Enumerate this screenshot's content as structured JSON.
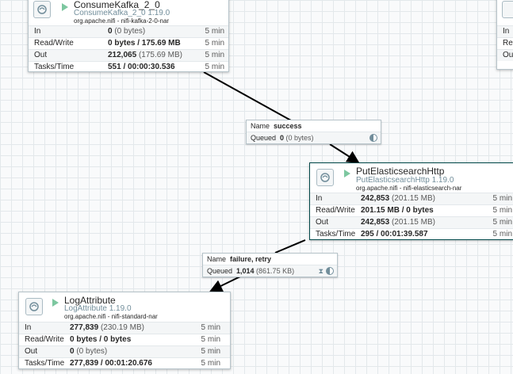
{
  "processors": {
    "consume_kafka": {
      "name": "ConsumeKafka_2_0",
      "type": "ConsumeKafka_2_0 1.19.0",
      "bundle": "org.apache.nifi - nifi-kafka-2-0-nar",
      "stats": [
        {
          "label": "In",
          "value": "0",
          "sub": "(0 bytes)",
          "time": "5 min"
        },
        {
          "label": "Read/Write",
          "value": "0 bytes / 175.69 MB",
          "sub": "",
          "time": "5 min"
        },
        {
          "label": "Out",
          "value": "212,065",
          "sub": "(175.69 MB)",
          "time": "5 min"
        },
        {
          "label": "Tasks/Time",
          "value": "551 / 00:00:30.536",
          "sub": "",
          "time": "5 min"
        }
      ]
    },
    "put_elasticsearch": {
      "name": "PutElasticsearchHttp",
      "type": "PutElasticsearchHttp 1.19.0",
      "bundle": "org.apache.nifi - nifi-elasticsearch-nar",
      "stats": [
        {
          "label": "In",
          "value": "242,853",
          "sub": "(201.15 MB)",
          "time": "5 min"
        },
        {
          "label": "Read/Write",
          "value": "201.15 MB / 0 bytes",
          "sub": "",
          "time": "5 min"
        },
        {
          "label": "Out",
          "value": "242,853",
          "sub": "(201.15 MB)",
          "time": "5 min"
        },
        {
          "label": "Tasks/Time",
          "value": "295 / 00:01:39.587",
          "sub": "",
          "time": "5 min"
        }
      ]
    },
    "log_attribute": {
      "name": "LogAttribute",
      "type": "LogAttribute 1.19.0",
      "bundle": "org.apache.nifi - nifi-standard-nar",
      "stats": [
        {
          "label": "In",
          "value": "277,839",
          "sub": "(230.19 MB)",
          "time": "5 min"
        },
        {
          "label": "Read/Write",
          "value": "0 bytes / 0 bytes",
          "sub": "",
          "time": "5 min"
        },
        {
          "label": "Out",
          "value": "0",
          "sub": "(0 bytes)",
          "time": "5 min"
        },
        {
          "label": "Tasks/Time",
          "value": "277,839 / 00:01:20.676",
          "sub": "",
          "time": "5 min"
        }
      ]
    },
    "partial_right": {
      "labels": [
        "In",
        "Rea",
        "Ou"
      ]
    }
  },
  "connections": {
    "success": {
      "name_key": "Name",
      "name_value": "success",
      "queued_key": "Queued",
      "queued_value": "0",
      "queued_sub": "(0 bytes)"
    },
    "failure_retry": {
      "name_key": "Name",
      "name_value": "failure, retry",
      "queued_key": "Queued",
      "queued_value": "1,014",
      "queued_sub": "(861.75 KB)"
    }
  },
  "icons": {
    "processor": "processor-icon",
    "run_state": "running-icon",
    "queue_prediction": "hourglass-icon",
    "queue_load": "pie-icon"
  },
  "colors": {
    "canvas_grid": "#e3e8eb",
    "running": "#7dc7a0",
    "selected_border": "#004849",
    "alert": "#ba554a",
    "connection": "#000000"
  }
}
